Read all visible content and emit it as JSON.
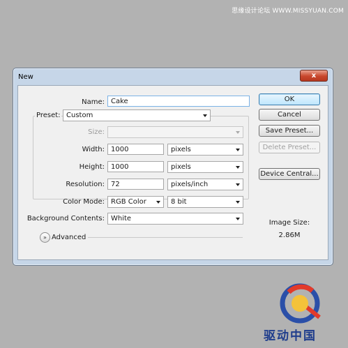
{
  "watermark": "思缘设计论坛 WWW.MISSYUAN.COM",
  "window": {
    "title": "New",
    "close_glyph": "x"
  },
  "form": {
    "name_label": "Name:",
    "name_value": "Cake",
    "preset_label": "Preset:",
    "preset_value": "Custom",
    "size_label": "Size:",
    "size_value": "",
    "width_label": "Width:",
    "width_value": "1000",
    "width_unit": "pixels",
    "height_label": "Height:",
    "height_value": "1000",
    "height_unit": "pixels",
    "resolution_label": "Resolution:",
    "resolution_value": "72",
    "resolution_unit": "pixels/inch",
    "color_mode_label": "Color Mode:",
    "color_mode_value": "RGB Color",
    "bit_depth_value": "8 bit",
    "background_label": "Background Contents:",
    "background_value": "White",
    "advanced_label": "Advanced"
  },
  "buttons": {
    "ok": "OK",
    "cancel": "Cancel",
    "save_preset": "Save Preset...",
    "delete_preset": "Delete Preset...",
    "device_central": "Device Central..."
  },
  "image_size": {
    "label": "Image Size:",
    "value": "2.86M"
  },
  "logo": {
    "text": "驱动中国"
  },
  "colors": {
    "titlebar": "#c6d6e8",
    "close": "#c8472c",
    "background": "#b2b2b2"
  }
}
